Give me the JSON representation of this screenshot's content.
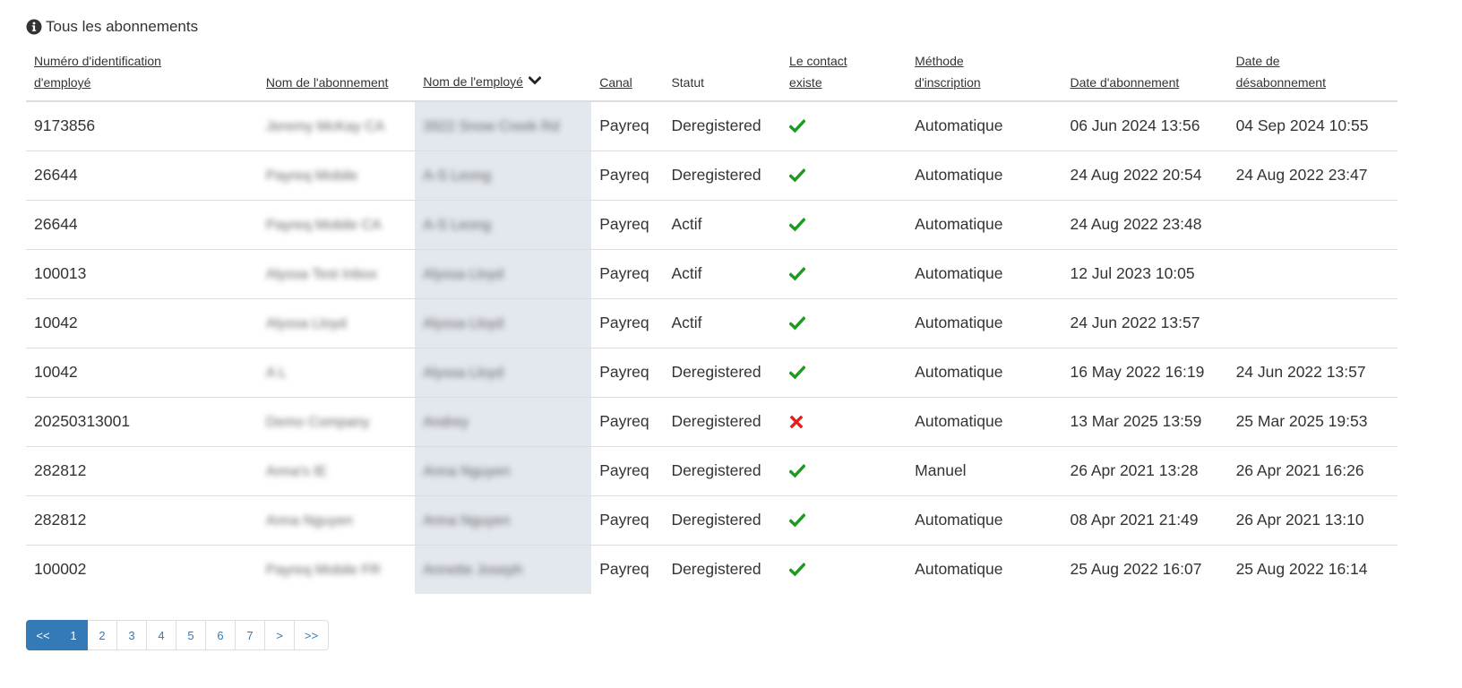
{
  "section": {
    "title": "Tous les abonnements",
    "icon": "info-circle-icon"
  },
  "table": {
    "columns": {
      "employee_id": {
        "line1": "Numéro d'identification",
        "line2": "d'employé"
      },
      "subscription_name": "Nom de l'abonnement",
      "employee_name": "Nom de l'employé",
      "channel": "Canal",
      "status": "Statut",
      "contact_exists": {
        "line1": "Le contact",
        "line2": "existe"
      },
      "signup_method": {
        "line1": "Méthode",
        "line2": "d'inscription"
      },
      "subscription_date": "Date d'abonnement",
      "unsubscription_date": {
        "line1": "Date de",
        "line2": "désabonnement"
      }
    },
    "rows": [
      {
        "employee_id": "9173856",
        "subscription_name": "Jeremy McKay CA",
        "employee_name": "3922 Snow Creek Rd",
        "channel": "Payreq",
        "status": "Deregistered",
        "contact_exists": true,
        "signup_method": "Automatique",
        "subscription_date": "06 Jun 2024 13:56",
        "unsubscription_date": "04 Sep 2024 10:55"
      },
      {
        "employee_id": "26644",
        "subscription_name": "Payreq Mobile",
        "employee_name": "A-S Leong",
        "channel": "Payreq",
        "status": "Deregistered",
        "contact_exists": true,
        "signup_method": "Automatique",
        "subscription_date": "24 Aug 2022 20:54",
        "unsubscription_date": "24 Aug 2022 23:47"
      },
      {
        "employee_id": "26644",
        "subscription_name": "Payreq Mobile CA",
        "employee_name": "A-S Leong",
        "channel": "Payreq",
        "status": "Actif",
        "contact_exists": true,
        "signup_method": "Automatique",
        "subscription_date": "24 Aug 2022 23:48",
        "unsubscription_date": ""
      },
      {
        "employee_id": "100013",
        "subscription_name": "Alyssa Test Inbox",
        "employee_name": "Alyssa Lloyd",
        "channel": "Payreq",
        "status": "Actif",
        "contact_exists": true,
        "signup_method": "Automatique",
        "subscription_date": "12 Jul 2023 10:05",
        "unsubscription_date": ""
      },
      {
        "employee_id": "10042",
        "subscription_name": "Alyssa Lloyd",
        "employee_name": "Alyssa Lloyd",
        "channel": "Payreq",
        "status": "Actif",
        "contact_exists": true,
        "signup_method": "Automatique",
        "subscription_date": "24 Jun 2022 13:57",
        "unsubscription_date": ""
      },
      {
        "employee_id": "10042",
        "subscription_name": "A L",
        "employee_name": "Alyssa Lloyd",
        "channel": "Payreq",
        "status": "Deregistered",
        "contact_exists": true,
        "signup_method": "Automatique",
        "subscription_date": "16 May 2022 16:19",
        "unsubscription_date": "24 Jun 2022 13:57"
      },
      {
        "employee_id": "20250313001",
        "subscription_name": "Demo Company",
        "employee_name": "Andrey",
        "channel": "Payreq",
        "status": "Deregistered",
        "contact_exists": false,
        "signup_method": "Automatique",
        "subscription_date": "13 Mar 2025 13:59",
        "unsubscription_date": "25 Mar 2025 19:53"
      },
      {
        "employee_id": "282812",
        "subscription_name": "Anna's IE",
        "employee_name": "Anna Nguyen",
        "channel": "Payreq",
        "status": "Deregistered",
        "contact_exists": true,
        "signup_method": "Manuel",
        "subscription_date": "26 Apr 2021 13:28",
        "unsubscription_date": "26 Apr 2021 16:26"
      },
      {
        "employee_id": "282812",
        "subscription_name": "Anna Nguyen",
        "employee_name": "Anna Nguyen",
        "channel": "Payreq",
        "status": "Deregistered",
        "contact_exists": true,
        "signup_method": "Automatique",
        "subscription_date": "08 Apr 2021 21:49",
        "unsubscription_date": "26 Apr 2021 13:10"
      },
      {
        "employee_id": "100002",
        "subscription_name": "Payreq Mobile FR",
        "employee_name": "Annette Joseph",
        "channel": "Payreq",
        "status": "Deregistered",
        "contact_exists": true,
        "signup_method": "Automatique",
        "subscription_date": "25 Aug 2022 16:07",
        "unsubscription_date": "25 Aug 2022 16:14"
      }
    ]
  },
  "pagination": {
    "first": "<<",
    "pages": [
      "1",
      "2",
      "3",
      "4",
      "5",
      "6",
      "7"
    ],
    "active_page": "1",
    "next": ">",
    "last": ">>"
  },
  "colors": {
    "check": "#1e9a1e",
    "cross": "#e02020",
    "accent": "#337ab7",
    "sorted_column_bg": "#e3e7ee"
  }
}
